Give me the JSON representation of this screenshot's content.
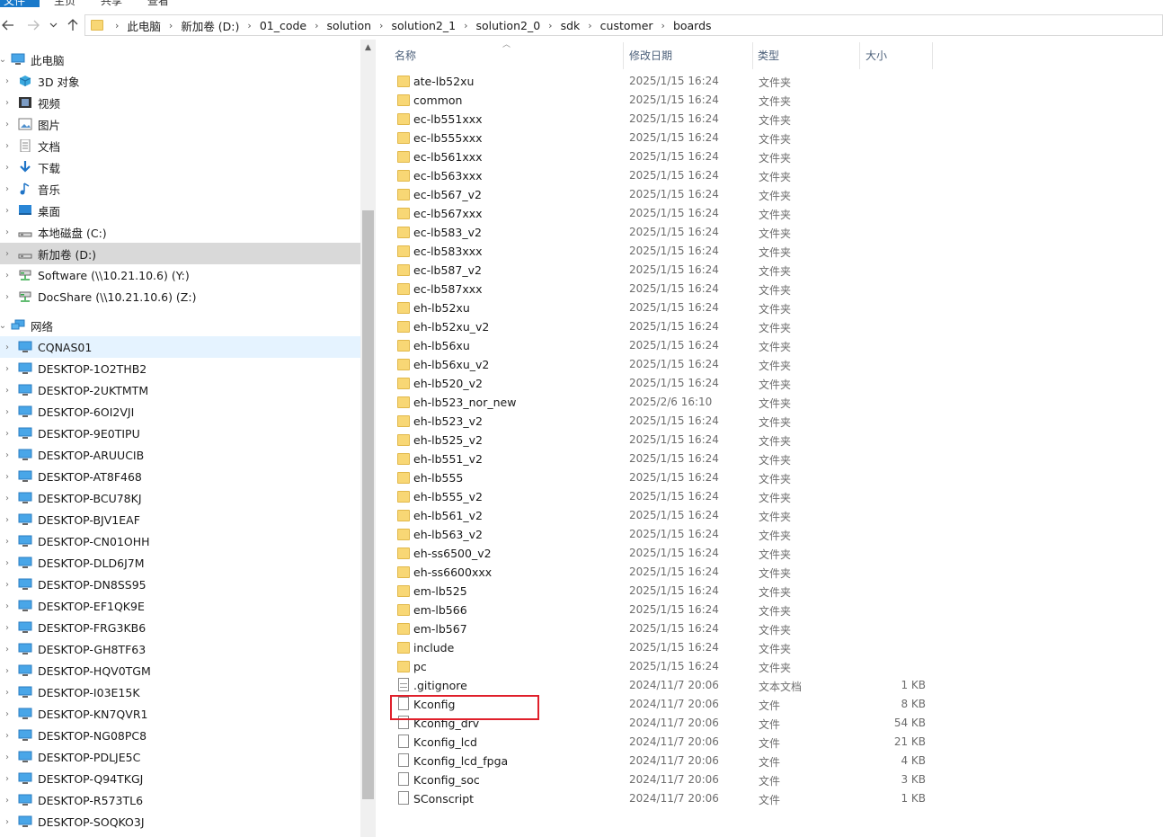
{
  "ribbon": {
    "tabs": [
      "文件",
      "主页",
      "共享",
      "查看"
    ]
  },
  "address": {
    "crumbs": [
      "此电脑",
      "新加卷 (D:)",
      "01_code",
      "solution",
      "solution2_1",
      "solution2_0",
      "sdk",
      "customer",
      "boards"
    ]
  },
  "nav": {
    "items": [
      {
        "label": "此电脑",
        "icon": "computer-icon",
        "chevron": "expanded",
        "indent": 0
      },
      {
        "label": "3D 对象",
        "icon": "3d-objects-icon",
        "chevron": "collapsed",
        "indent": 1
      },
      {
        "label": "视频",
        "icon": "video-icon",
        "chevron": "collapsed",
        "indent": 1
      },
      {
        "label": "图片",
        "icon": "pictures-icon",
        "chevron": "collapsed",
        "indent": 1
      },
      {
        "label": "文档",
        "icon": "documents-icon",
        "chevron": "collapsed",
        "indent": 1
      },
      {
        "label": "下载",
        "icon": "download-icon",
        "chevron": "collapsed",
        "indent": 1
      },
      {
        "label": "音乐",
        "icon": "music-icon",
        "chevron": "collapsed",
        "indent": 1
      },
      {
        "label": "桌面",
        "icon": "desktop-icon",
        "chevron": "collapsed",
        "indent": 1
      },
      {
        "label": "本地磁盘 (C:)",
        "icon": "drive-icon",
        "chevron": "collapsed",
        "indent": 1
      },
      {
        "label": "新加卷 (D:)",
        "icon": "drive-icon",
        "chevron": "collapsed",
        "indent": 1,
        "state": "selected"
      },
      {
        "label": "Software (\\\\10.21.10.6) (Y:)",
        "icon": "network-drive-icon",
        "chevron": "collapsed",
        "indent": 1
      },
      {
        "label": "DocShare (\\\\10.21.10.6) (Z:)",
        "icon": "network-drive-icon",
        "chevron": "collapsed",
        "indent": 1
      },
      {
        "label": "网络",
        "icon": "network-icon",
        "chevron": "expanded",
        "indent": 0
      },
      {
        "label": "CQNAS01",
        "icon": "computer-icon",
        "chevron": "collapsed",
        "indent": 1,
        "state": "hover"
      },
      {
        "label": "DESKTOP-1O2THB2",
        "icon": "computer-icon",
        "chevron": "collapsed",
        "indent": 1
      },
      {
        "label": "DESKTOP-2UKTMTM",
        "icon": "computer-icon",
        "chevron": "collapsed",
        "indent": 1
      },
      {
        "label": "DESKTOP-6OI2VJI",
        "icon": "computer-icon",
        "chevron": "collapsed",
        "indent": 1
      },
      {
        "label": "DESKTOP-9E0TIPU",
        "icon": "computer-icon",
        "chevron": "collapsed",
        "indent": 1
      },
      {
        "label": "DESKTOP-ARUUCIB",
        "icon": "computer-icon",
        "chevron": "collapsed",
        "indent": 1
      },
      {
        "label": "DESKTOP-AT8F468",
        "icon": "computer-icon",
        "chevron": "collapsed",
        "indent": 1
      },
      {
        "label": "DESKTOP-BCU78KJ",
        "icon": "computer-icon",
        "chevron": "collapsed",
        "indent": 1
      },
      {
        "label": "DESKTOP-BJV1EAF",
        "icon": "computer-icon",
        "chevron": "collapsed",
        "indent": 1
      },
      {
        "label": "DESKTOP-CN01OHH",
        "icon": "computer-icon",
        "chevron": "collapsed",
        "indent": 1
      },
      {
        "label": "DESKTOP-DLD6J7M",
        "icon": "computer-icon",
        "chevron": "collapsed",
        "indent": 1
      },
      {
        "label": "DESKTOP-DN8SS95",
        "icon": "computer-icon",
        "chevron": "collapsed",
        "indent": 1
      },
      {
        "label": "DESKTOP-EF1QK9E",
        "icon": "computer-icon",
        "chevron": "collapsed",
        "indent": 1
      },
      {
        "label": "DESKTOP-FRG3KB6",
        "icon": "computer-icon",
        "chevron": "collapsed",
        "indent": 1
      },
      {
        "label": "DESKTOP-GH8TF63",
        "icon": "computer-icon",
        "chevron": "collapsed",
        "indent": 1
      },
      {
        "label": "DESKTOP-HQV0TGM",
        "icon": "computer-icon",
        "chevron": "collapsed",
        "indent": 1
      },
      {
        "label": "DESKTOP-I03E15K",
        "icon": "computer-icon",
        "chevron": "collapsed",
        "indent": 1
      },
      {
        "label": "DESKTOP-KN7QVR1",
        "icon": "computer-icon",
        "chevron": "collapsed",
        "indent": 1
      },
      {
        "label": "DESKTOP-NG08PC8",
        "icon": "computer-icon",
        "chevron": "collapsed",
        "indent": 1
      },
      {
        "label": "DESKTOP-PDLJE5C",
        "icon": "computer-icon",
        "chevron": "collapsed",
        "indent": 1
      },
      {
        "label": "DESKTOP-Q94TKGJ",
        "icon": "computer-icon",
        "chevron": "collapsed",
        "indent": 1
      },
      {
        "label": "DESKTOP-R573TL6",
        "icon": "computer-icon",
        "chevron": "collapsed",
        "indent": 1
      },
      {
        "label": "DESKTOP-SOQKO3J",
        "icon": "computer-icon",
        "chevron": "collapsed",
        "indent": 1
      }
    ]
  },
  "columns": {
    "name": "名称",
    "date": "修改日期",
    "type": "类型",
    "size": "大小"
  },
  "files": [
    {
      "name": "ate-lb52xu",
      "date": "2025/1/15 16:24",
      "type": "文件夹",
      "size": "",
      "kind": "folder"
    },
    {
      "name": "common",
      "date": "2025/1/15 16:24",
      "type": "文件夹",
      "size": "",
      "kind": "folder"
    },
    {
      "name": "ec-lb551xxx",
      "date": "2025/1/15 16:24",
      "type": "文件夹",
      "size": "",
      "kind": "folder"
    },
    {
      "name": "ec-lb555xxx",
      "date": "2025/1/15 16:24",
      "type": "文件夹",
      "size": "",
      "kind": "folder"
    },
    {
      "name": "ec-lb561xxx",
      "date": "2025/1/15 16:24",
      "type": "文件夹",
      "size": "",
      "kind": "folder"
    },
    {
      "name": "ec-lb563xxx",
      "date": "2025/1/15 16:24",
      "type": "文件夹",
      "size": "",
      "kind": "folder"
    },
    {
      "name": "ec-lb567_v2",
      "date": "2025/1/15 16:24",
      "type": "文件夹",
      "size": "",
      "kind": "folder"
    },
    {
      "name": "ec-lb567xxx",
      "date": "2025/1/15 16:24",
      "type": "文件夹",
      "size": "",
      "kind": "folder"
    },
    {
      "name": "ec-lb583_v2",
      "date": "2025/1/15 16:24",
      "type": "文件夹",
      "size": "",
      "kind": "folder"
    },
    {
      "name": "ec-lb583xxx",
      "date": "2025/1/15 16:24",
      "type": "文件夹",
      "size": "",
      "kind": "folder"
    },
    {
      "name": "ec-lb587_v2",
      "date": "2025/1/15 16:24",
      "type": "文件夹",
      "size": "",
      "kind": "folder"
    },
    {
      "name": "ec-lb587xxx",
      "date": "2025/1/15 16:24",
      "type": "文件夹",
      "size": "",
      "kind": "folder"
    },
    {
      "name": "eh-lb52xu",
      "date": "2025/1/15 16:24",
      "type": "文件夹",
      "size": "",
      "kind": "folder"
    },
    {
      "name": "eh-lb52xu_v2",
      "date": "2025/1/15 16:24",
      "type": "文件夹",
      "size": "",
      "kind": "folder"
    },
    {
      "name": "eh-lb56xu",
      "date": "2025/1/15 16:24",
      "type": "文件夹",
      "size": "",
      "kind": "folder"
    },
    {
      "name": "eh-lb56xu_v2",
      "date": "2025/1/15 16:24",
      "type": "文件夹",
      "size": "",
      "kind": "folder"
    },
    {
      "name": "eh-lb520_v2",
      "date": "2025/1/15 16:24",
      "type": "文件夹",
      "size": "",
      "kind": "folder"
    },
    {
      "name": "eh-lb523_nor_new",
      "date": "2025/2/6 16:10",
      "type": "文件夹",
      "size": "",
      "kind": "folder"
    },
    {
      "name": "eh-lb523_v2",
      "date": "2025/1/15 16:24",
      "type": "文件夹",
      "size": "",
      "kind": "folder"
    },
    {
      "name": "eh-lb525_v2",
      "date": "2025/1/15 16:24",
      "type": "文件夹",
      "size": "",
      "kind": "folder"
    },
    {
      "name": "eh-lb551_v2",
      "date": "2025/1/15 16:24",
      "type": "文件夹",
      "size": "",
      "kind": "folder"
    },
    {
      "name": "eh-lb555",
      "date": "2025/1/15 16:24",
      "type": "文件夹",
      "size": "",
      "kind": "folder"
    },
    {
      "name": "eh-lb555_v2",
      "date": "2025/1/15 16:24",
      "type": "文件夹",
      "size": "",
      "kind": "folder"
    },
    {
      "name": "eh-lb561_v2",
      "date": "2025/1/15 16:24",
      "type": "文件夹",
      "size": "",
      "kind": "folder"
    },
    {
      "name": "eh-lb563_v2",
      "date": "2025/1/15 16:24",
      "type": "文件夹",
      "size": "",
      "kind": "folder"
    },
    {
      "name": "eh-ss6500_v2",
      "date": "2025/1/15 16:24",
      "type": "文件夹",
      "size": "",
      "kind": "folder"
    },
    {
      "name": "eh-ss6600xxx",
      "date": "2025/1/15 16:24",
      "type": "文件夹",
      "size": "",
      "kind": "folder"
    },
    {
      "name": "em-lb525",
      "date": "2025/1/15 16:24",
      "type": "文件夹",
      "size": "",
      "kind": "folder"
    },
    {
      "name": "em-lb566",
      "date": "2025/1/15 16:24",
      "type": "文件夹",
      "size": "",
      "kind": "folder"
    },
    {
      "name": "em-lb567",
      "date": "2025/1/15 16:24",
      "type": "文件夹",
      "size": "",
      "kind": "folder"
    },
    {
      "name": "include",
      "date": "2025/1/15 16:24",
      "type": "文件夹",
      "size": "",
      "kind": "folder"
    },
    {
      "name": "pc",
      "date": "2025/1/15 16:24",
      "type": "文件夹",
      "size": "",
      "kind": "folder"
    },
    {
      "name": ".gitignore",
      "date": "2024/11/7 20:06",
      "type": "文本文档",
      "size": "1 KB",
      "kind": "textfile"
    },
    {
      "name": "Kconfig",
      "date": "2024/11/7 20:06",
      "type": "文件",
      "size": "8 KB",
      "kind": "file",
      "highlighted": true
    },
    {
      "name": "Kconfig_drv",
      "date": "2024/11/7 20:06",
      "type": "文件",
      "size": "54 KB",
      "kind": "file"
    },
    {
      "name": "Kconfig_lcd",
      "date": "2024/11/7 20:06",
      "type": "文件",
      "size": "21 KB",
      "kind": "file"
    },
    {
      "name": "Kconfig_lcd_fpga",
      "date": "2024/11/7 20:06",
      "type": "文件",
      "size": "4 KB",
      "kind": "file"
    },
    {
      "name": "Kconfig_soc",
      "date": "2024/11/7 20:06",
      "type": "文件",
      "size": "3 KB",
      "kind": "file"
    },
    {
      "name": "SConscript",
      "date": "2024/11/7 20:06",
      "type": "文件",
      "size": "1 KB",
      "kind": "file"
    }
  ],
  "colors": {
    "selected": "#d9d9d9",
    "hover": "#e5f3ff",
    "highlight_box": "#e0202b",
    "folder": "#f8d775",
    "accent": "#1979ca"
  }
}
